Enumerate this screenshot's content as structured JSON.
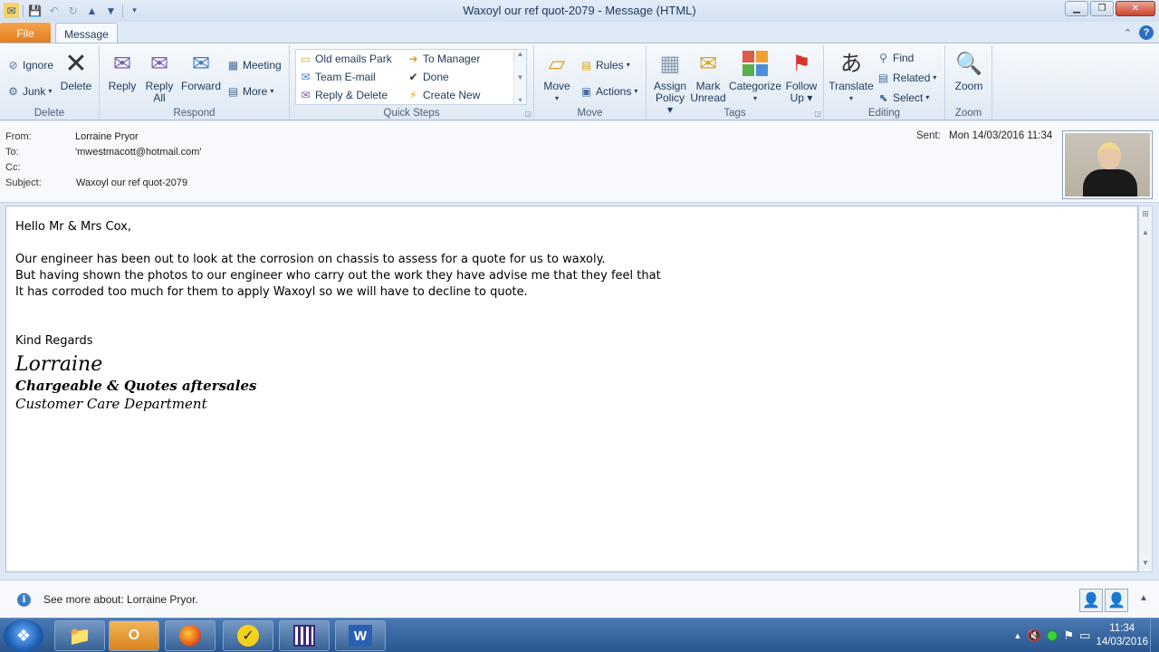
{
  "window": {
    "title": "Waxoyl our ref quot-2079  -  Message (HTML)"
  },
  "tabs": {
    "file": "File",
    "message": "Message"
  },
  "ribbon": {
    "delete": {
      "label": "Delete",
      "ignore": "Ignore",
      "junk": "Junk",
      "delete_btn": "Delete"
    },
    "respond": {
      "label": "Respond",
      "reply": "Reply",
      "reply_all_1": "Reply",
      "reply_all_2": "All",
      "forward": "Forward",
      "meeting": "Meeting",
      "more": "More"
    },
    "quick_steps": {
      "label": "Quick Steps",
      "items": [
        "Old emails Park",
        "To Manager",
        "Team E-mail",
        "Done",
        "Reply & Delete",
        "Create New"
      ]
    },
    "move": {
      "label": "Move",
      "move_btn": "Move",
      "rules": "Rules",
      "actions": "Actions"
    },
    "tags": {
      "label": "Tags",
      "assign_1": "Assign",
      "assign_2": "Policy",
      "mark_1": "Mark",
      "mark_2": "Unread",
      "categorize": "Categorize",
      "follow_1": "Follow",
      "follow_2": "Up"
    },
    "editing": {
      "label": "Editing",
      "translate": "Translate",
      "find": "Find",
      "related": "Related",
      "select": "Select"
    },
    "zoom": {
      "label": "Zoom",
      "zoom_btn": "Zoom"
    }
  },
  "header": {
    "from_label": "From:",
    "from": "Lorraine Pryor",
    "to_label": "To:",
    "to": "'mwestmacott@hotmail.com'",
    "cc_label": "Cc:",
    "cc": "",
    "subject_label": "Subject:",
    "subject": "Waxoyl our ref quot-2079",
    "sent_label": "Sent:",
    "sent": "Mon 14/03/2016 11:34"
  },
  "body": {
    "greeting": "Hello Mr & Mrs Cox,",
    "line1": "Our engineer has been out to look at the corrosion on chassis to assess for a quote for us to waxoly.",
    "line2": "But having shown the photos to our engineer who carry out the work they have advise me that they feel that",
    "line3": "It has corroded too much for them to apply Waxoyl so we will have to decline to quote.",
    "closing": "Kind Regards",
    "sig_name": "Lorraine",
    "sig_title": "Chargeable & Quotes aftersales",
    "sig_dept": "Customer Care Department"
  },
  "people_pane": {
    "text": "See more about: Lorraine Pryor."
  },
  "taskbar": {
    "time": "11:34",
    "date": "14/03/2016"
  }
}
